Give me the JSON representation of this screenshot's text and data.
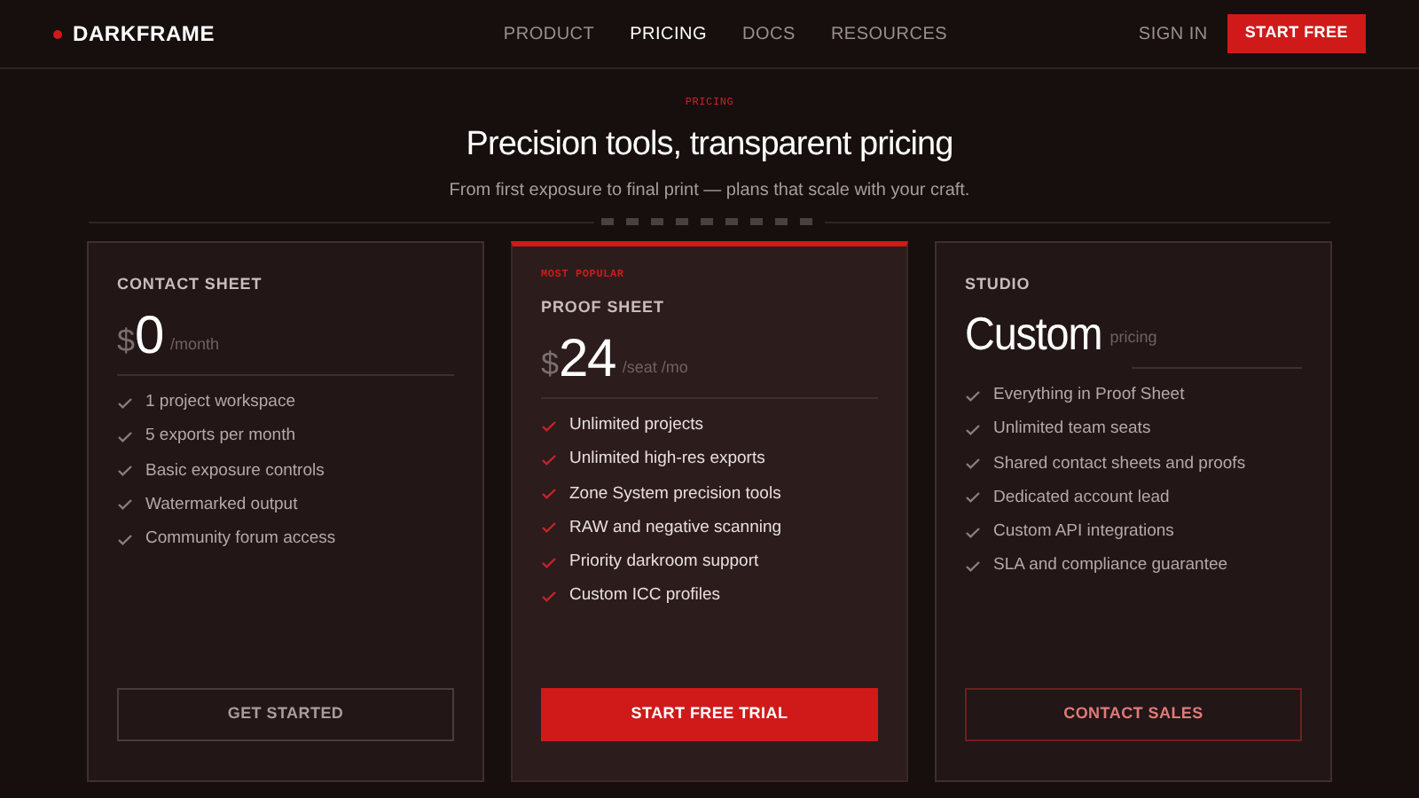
{
  "brand": "DARKFRAME",
  "nav": [
    {
      "label": "PRODUCT",
      "selected": false
    },
    {
      "label": "PRICING",
      "selected": true
    },
    {
      "label": "DOCS",
      "selected": false
    },
    {
      "label": "RESOURCES",
      "selected": false
    }
  ],
  "sign_in": "SIGN IN",
  "cta": "START FREE",
  "hero": {
    "eyebrow": "PRICING",
    "title": "Precision tools, transparent pricing",
    "subtitle": "From first exposure to final print — plans that scale with your craft."
  },
  "plans": [
    {
      "kind": "standard",
      "name": "CONTACT SHEET",
      "currency": "$",
      "amount": "0",
      "period": "/month",
      "features": [
        "1 project workspace",
        "5 exports per month",
        "Basic exposure controls",
        "Watermarked output",
        "Community forum access"
      ],
      "button": {
        "label": "GET STARTED",
        "kind": "outline"
      }
    },
    {
      "kind": "featured",
      "badge": "MOST POPULAR",
      "name": "PROOF SHEET",
      "currency": "$",
      "amount": "24",
      "period": "/seat /mo",
      "features": [
        "Unlimited projects",
        "Unlimited high-res exports",
        "Zone System precision tools",
        "RAW and negative scanning",
        "Priority darkroom support",
        "Custom ICC profiles"
      ],
      "button": {
        "label": "START FREE TRIAL",
        "kind": "primary"
      }
    },
    {
      "kind": "standard",
      "name": "STUDIO",
      "amount": "Custom",
      "period": "pricing",
      "features": [
        "Everything in Proof Sheet",
        "Unlimited team seats",
        "Shared contact sheets and proofs",
        "Dedicated account lead",
        "Custom API integrations",
        "SLA and compliance guarantee"
      ],
      "button": {
        "label": "CONTACT SALES",
        "kind": "accent"
      }
    }
  ]
}
